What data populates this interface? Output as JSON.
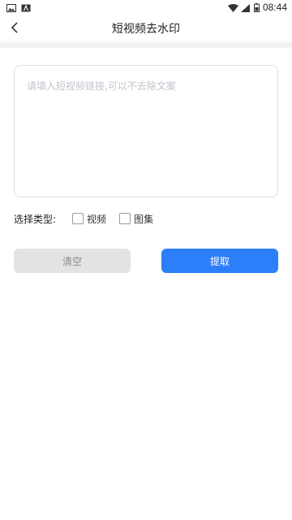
{
  "status_bar": {
    "time": "08:44",
    "icons": [
      "image-icon",
      "text-icon",
      "wifi-icon",
      "signal-icon",
      "battery-icon"
    ]
  },
  "header": {
    "title": "短视频去水印",
    "back_icon": "chevron-left-icon"
  },
  "input": {
    "placeholder": "请填入短视频链接,可以不去除文案",
    "value": ""
  },
  "type_selection": {
    "label": "选择类型:",
    "options": [
      {
        "label": "视频",
        "checked": false
      },
      {
        "label": "图集",
        "checked": false
      }
    ]
  },
  "buttons": {
    "clear": "清空",
    "extract": "提取"
  },
  "colors": {
    "primary": "#2d7ff9",
    "secondary_button": "#e3e3e3",
    "divider": "#f2f2f4"
  }
}
